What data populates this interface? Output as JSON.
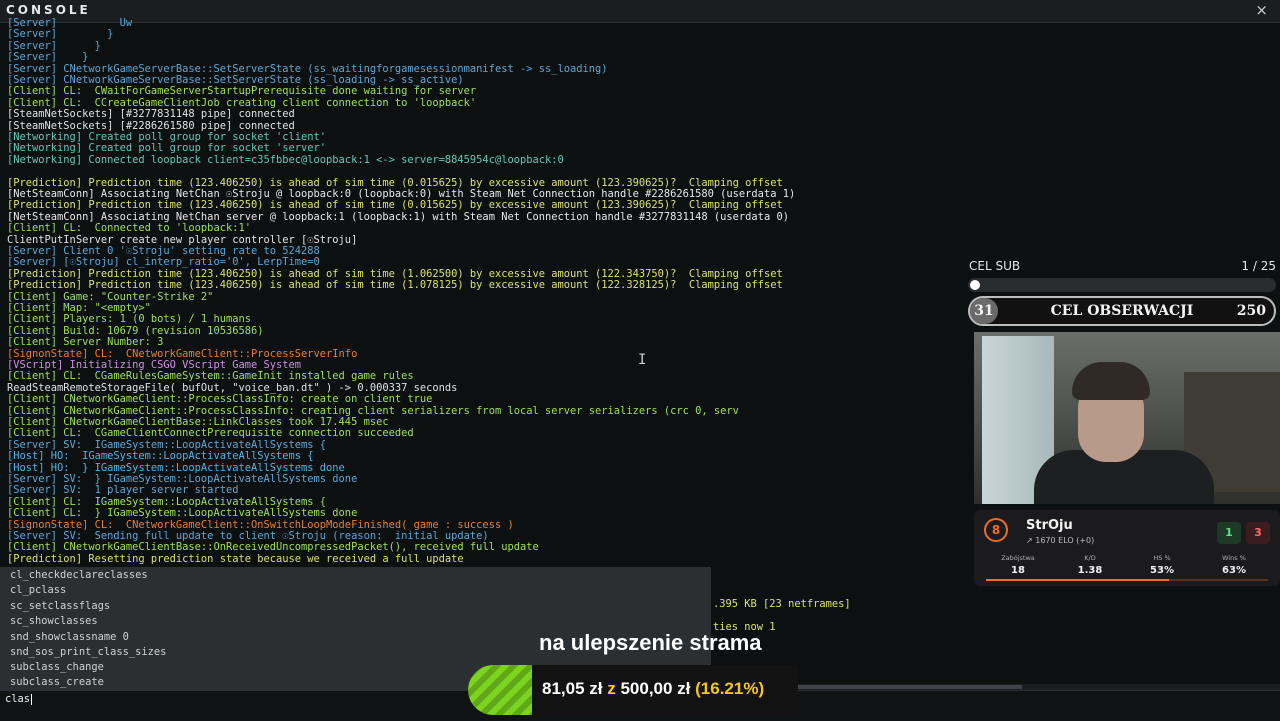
{
  "window": {
    "title": "CONSOLE",
    "close_icon": "×"
  },
  "log": [
    {
      "text": "[Server]          Uw",
      "cls": "c-server"
    },
    {
      "text": "[Server]        }",
      "cls": "c-server"
    },
    {
      "text": "[Server]      }",
      "cls": "c-server"
    },
    {
      "text": "[Server]    }",
      "cls": "c-server"
    },
    {
      "text": "[Server] CNetworkGameServerBase::SetServerState (ss_waitingforgamesessionmanifest -> ss_loading)",
      "cls": "c-server"
    },
    {
      "text": "[Server] CNetworkGameServerBase::SetServerState (ss_loading -> ss_active)",
      "cls": "c-server"
    },
    {
      "text": "[Client] CL:  CWaitForGameServerStartupPrerequisite done waiting for server",
      "cls": "c-client"
    },
    {
      "text": "[Client] CL:  CCreateGameClientJob creating client connection to 'loopback'",
      "cls": "c-client"
    },
    {
      "text": "[SteamNetSockets] [#3277831148 pipe] connected",
      "cls": "c-white"
    },
    {
      "text": "[SteamNetSockets] [#2286261580 pipe] connected",
      "cls": "c-white"
    },
    {
      "text": "[Networking] Created poll group for socket 'client'",
      "cls": "c-net"
    },
    {
      "text": "[Networking] Created poll group for socket 'server'",
      "cls": "c-net"
    },
    {
      "text": "[Networking] Connected loopback client=c35fbbec@loopback:1 <-> server=8845954c@loopback:0",
      "cls": "c-net"
    },
    {
      "text": "",
      "cls": "c-white"
    },
    {
      "text": "[Prediction] Prediction time (123.406250) is ahead of sim time (0.015625) by excessive amount (123.390625)?  Clamping offset",
      "cls": "c-pred"
    },
    {
      "text": "[NetSteamConn] Associating NetChan ☉Stroju @ loopback:0 (loopback:0) with Steam Net Connection handle #2286261580 (userdata 1)",
      "cls": "c-netsteam"
    },
    {
      "text": "[Prediction] Prediction time (123.406250) is ahead of sim time (0.015625) by excessive amount (123.390625)?  Clamping offset",
      "cls": "c-pred"
    },
    {
      "text": "[NetSteamConn] Associating NetChan server @ loopback:1 (loopback:1) with Steam Net Connection handle #3277831148 (userdata 0)",
      "cls": "c-netsteam"
    },
    {
      "text": "[Client] CL:  Connected to 'loopback:1'",
      "cls": "c-client"
    },
    {
      "text": "ClientPutInServer create new player controller [☉Stroju]",
      "cls": "c-white"
    },
    {
      "text": "[Server] Client 0 '☉Stroju' setting rate to 524288",
      "cls": "c-server"
    },
    {
      "text": "[Server] [☉Stroju] cl_interp_ratio='0', LerpTime=0",
      "cls": "c-server"
    },
    {
      "text": "[Prediction] Prediction time (123.406250) is ahead of sim time (1.062500) by excessive amount (122.343750)?  Clamping offset",
      "cls": "c-pred"
    },
    {
      "text": "[Prediction] Prediction time (123.406250) is ahead of sim time (1.078125) by excessive amount (122.328125)?  Clamping offset",
      "cls": "c-pred"
    },
    {
      "text": "[Client] Game: \"Counter-Strike 2\"",
      "cls": "c-client"
    },
    {
      "text": "[Client] Map: \"<empty>\"",
      "cls": "c-client"
    },
    {
      "text": "[Client] Players: 1 (0 bots) / 1 humans",
      "cls": "c-client"
    },
    {
      "text": "[Client] Build: 10679 (revision 10536586)",
      "cls": "c-client"
    },
    {
      "text": "[Client] Server Number: 3",
      "cls": "c-client"
    },
    {
      "text": "[SignonState] CL:  CNetworkGameClient::ProcessServerInfo",
      "cls": "c-signon"
    },
    {
      "text": "[VScript] Initializing CSGO VScript Game System",
      "cls": "c-vscript"
    },
    {
      "text": "[Client] CL:  CGameRulesGameSystem::GameInit installed game rules",
      "cls": "c-client"
    },
    {
      "text": "ReadSteamRemoteStorageFile( bufOut, \"voice_ban.dt\" ) -> 0.000337 seconds",
      "cls": "c-white"
    },
    {
      "text": "[Client] CNetworkGameClient::ProcessClassInfo: create on client true",
      "cls": "c-client"
    },
    {
      "text": "[Client] CNetworkGameClient::ProcessClassInfo: creating client serializers from local server serializers (crc 0, serv",
      "cls": "c-client"
    },
    {
      "text": "[Client] CNetworkGameClientBase::LinkClasses took 17.445 msec",
      "cls": "c-client"
    },
    {
      "text": "[Client] CL:  CGameClientConnectPrerequisite connection succeeded",
      "cls": "c-client"
    },
    {
      "text": "[Server] SV:  IGameSystem::LoopActivateAllSystems {",
      "cls": "c-server"
    },
    {
      "text": "[Host] HO:  IGameSystem::LoopActivateAllSystems {",
      "cls": "c-host"
    },
    {
      "text": "[Host] HO:  } IGameSystem::LoopActivateAllSystems done",
      "cls": "c-host"
    },
    {
      "text": "[Server] SV:  } IGameSystem::LoopActivateAllSystems done",
      "cls": "c-server"
    },
    {
      "text": "[Server] SV:  1 player server started",
      "cls": "c-server"
    },
    {
      "text": "[Client] CL:  IGameSystem::LoopActivateAllSystems {",
      "cls": "c-client"
    },
    {
      "text": "[Client] CL:  } IGameSystem::LoopActivateAllSystems done",
      "cls": "c-client"
    },
    {
      "text": "[SignonState] CL:  CNetworkGameClient::OnSwitchLoopModeFinished( game : success )",
      "cls": "c-signon"
    },
    {
      "text": "[Server] SV:  Sending full update to client ☉Stroju (reason:  initial update)",
      "cls": "c-server"
    },
    {
      "text": "[Client] CNetworkGameClientBase::OnReceivedUncompressedPacket(), received full update",
      "cls": "c-client"
    },
    {
      "text": "[Prediction] Resetting prediction state because we received a full update",
      "cls": "c-pred"
    }
  ],
  "log_fragments": [
    ".395 KB [23 netframes]",
    "ties now 1"
  ],
  "autocomplete": [
    "cl_checkdeclareclasses",
    "cl_pclass",
    "sc_setclassflags",
    "sc_showclasses",
    "snd_showclassname 0",
    "snd_sos_print_class_sizes",
    "subclass_change",
    "subclass_create"
  ],
  "input": {
    "value": "clas"
  },
  "overlay": {
    "sub_goal": {
      "label": "CEL SUB",
      "progress": "1 / 25",
      "fraction": 0.04
    },
    "observation_goal": {
      "current": "31",
      "label": "CEL OBSERWACJI",
      "target": "250"
    },
    "faceit": {
      "level": "8",
      "name": "StrOju",
      "elo": "↗ 1670 ELO (+0)",
      "wins": "1",
      "losses": "3",
      "stats": [
        {
          "label": "Zabójstwa",
          "value": "18"
        },
        {
          "label": "K/D",
          "value": "1.38"
        },
        {
          "label": "HS %",
          "value": "53%"
        },
        {
          "label": "Wins %",
          "value": "63%"
        }
      ],
      "level_progress": 0.65
    },
    "donation": {
      "title": "na ulepszenie strama",
      "current": "81,05 zł",
      "separator": " z ",
      "goal": "500,00 zł",
      "percent_text": "(16.21%)",
      "fraction": 0.1621
    }
  },
  "colors": {
    "server": "#5ba7d6",
    "client": "#9fe05a",
    "prediction": "#dbe26e",
    "signon": "#e87f2f",
    "vscript": "#d38be8",
    "faceit_accent": "#f36c21",
    "donation_fill": "#7ed321"
  }
}
